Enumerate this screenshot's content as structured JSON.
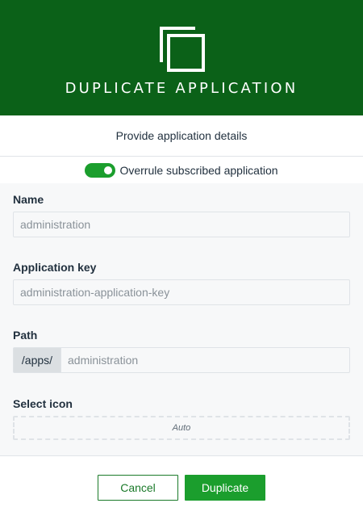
{
  "header": {
    "title": "DUPLICATE APPLICATION",
    "icon": "duplicate-icon"
  },
  "subheader": {
    "text": "Provide application details"
  },
  "toggle": {
    "label": "Overrule subscribed application",
    "checked": true
  },
  "fields": {
    "name": {
      "label": "Name",
      "placeholder": "administration"
    },
    "app_key": {
      "label": "Application key",
      "placeholder": "administration-application-key"
    },
    "path": {
      "label": "Path",
      "prefix": "/apps/",
      "placeholder": "administration"
    },
    "select_icon": {
      "label": "Select icon",
      "value": "Auto"
    }
  },
  "footer": {
    "cancel_label": "Cancel",
    "primary_label": "Duplicate"
  },
  "colors": {
    "header_bg": "#0b6118",
    "accent": "#1b9e2d"
  }
}
